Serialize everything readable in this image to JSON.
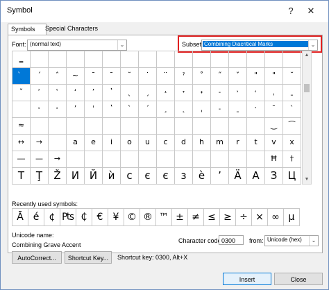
{
  "window": {
    "title": "Symbol"
  },
  "tabs": [
    {
      "label": "Symbols",
      "active": true
    },
    {
      "label": "Special Characters",
      "active": false
    }
  ],
  "font": {
    "label": "Font:",
    "value": "(normal text)"
  },
  "subset": {
    "label": "Subset:",
    "value": "Combining Diacritical Marks"
  },
  "symbols": {
    "rows": [
      [
        "‗",
        "",
        "",
        "",
        "",
        "",
        "",
        "",
        "",
        "",
        "",
        "",
        "",
        "",
        "",
        ""
      ],
      [
        "̀",
        "´",
        "ˆ",
        "~",
        "ˉ",
        "¯",
        "˘",
        "˙",
        "¨",
        "ˀ",
        "˚",
        "˝",
        "ˇ",
        "\"",
        "\"",
        "˘"
      ],
      [
        "˅",
        "ʾ",
        "ʿ",
        "ʻ",
        "ʼ",
        "ʽ",
        "ˎ",
        "ˏ",
        "˔",
        "˕",
        "˖",
        "˗",
        "˒",
        "˓",
        "ˌ",
        "ˍ"
      ],
      [
        "",
        "˓",
        "˒",
        "ʼ",
        "ˈ",
        "ʽ",
        "ˋ",
        "ˊ",
        "¸",
        "˛",
        "ˌ",
        "˗",
        "ˍ",
        "ˑ",
        "ˉ",
        "ˋ"
      ],
      [
        "≈",
        "",
        "",
        "",
        "",
        "",
        "",
        "",
        "",
        "",
        "",
        "",
        "",
        "",
        "‿",
        "⁀"
      ],
      [
        "↔",
        "→",
        "",
        "a",
        "e",
        "i",
        "o",
        "u",
        "c",
        "d",
        "h",
        "m",
        "r",
        "t",
        "v",
        "x"
      ],
      [
        "―",
        "—",
        "→",
        "",
        "",
        "",
        "",
        "",
        "",
        "",
        "",
        "",
        "",
        "",
        "Ħ",
        "†"
      ],
      [
        "T",
        "Ţ",
        "Ž",
        "И",
        "Й",
        "ѝ",
        "с",
        "є",
        "є",
        "з",
        "ѐ",
        "ʼ",
        "Ä",
        "А",
        "З",
        "Ц"
      ]
    ]
  },
  "recent": {
    "label": "Recently used symbols:",
    "symbols": [
      "Ā",
      "é",
      "¢",
      "₧",
      "₵",
      "€",
      "¥",
      "©",
      "®",
      "™",
      "±",
      "≠",
      "≤",
      "≥",
      "÷",
      "×",
      "∞",
      "µ"
    ]
  },
  "unicode": {
    "label": "Unicode name:",
    "value": "Combining Grave Accent"
  },
  "char_code": {
    "label": "Character code:",
    "value": "0300"
  },
  "from": {
    "label": "from:",
    "value": "Unicode (hex)"
  },
  "shortcut": {
    "text": "Shortcut key: 0300, Alt+X"
  },
  "buttons": {
    "autocorrect": "AutoCorrect...",
    "shortcut_key": "Shortcut Key...",
    "insert": "Insert",
    "close": "Close"
  },
  "colors": {
    "accent": "#0078d7",
    "highlight_box": "#e02020"
  }
}
